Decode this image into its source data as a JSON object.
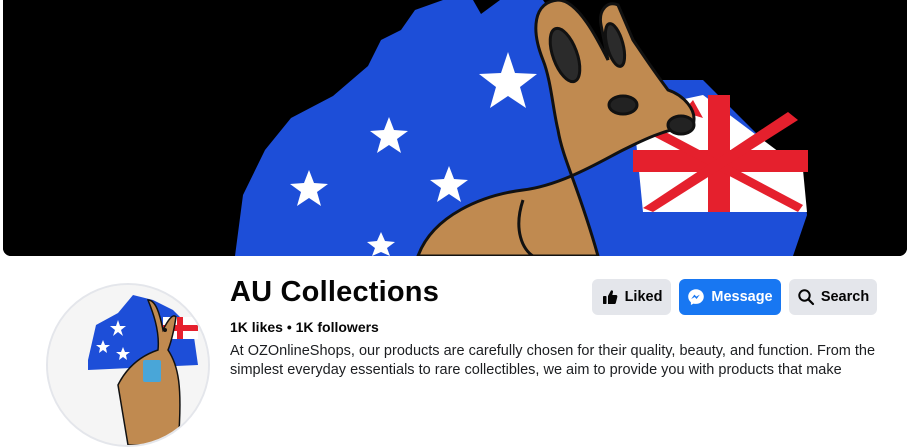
{
  "page": {
    "name": "AU Collections",
    "stats": "1K likes • 1K followers",
    "about": "At OZOnlineShops, our products are carefully chosen for their quality, beauty, and function. From the simplest everyday essentials to rare collectibles, we aim to provide you with products that make"
  },
  "actions": {
    "liked_label": "Liked",
    "message_label": "Message",
    "search_label": "Search"
  },
  "icons": {
    "liked": "thumbs-up-icon",
    "message": "messenger-icon",
    "search": "search-icon"
  },
  "colors": {
    "primary": "#1877f2",
    "secondary_button": "#e4e6eb",
    "cover_background": "#000000",
    "map_blue": "#1d4ed8",
    "flag_red": "#e5202d"
  }
}
